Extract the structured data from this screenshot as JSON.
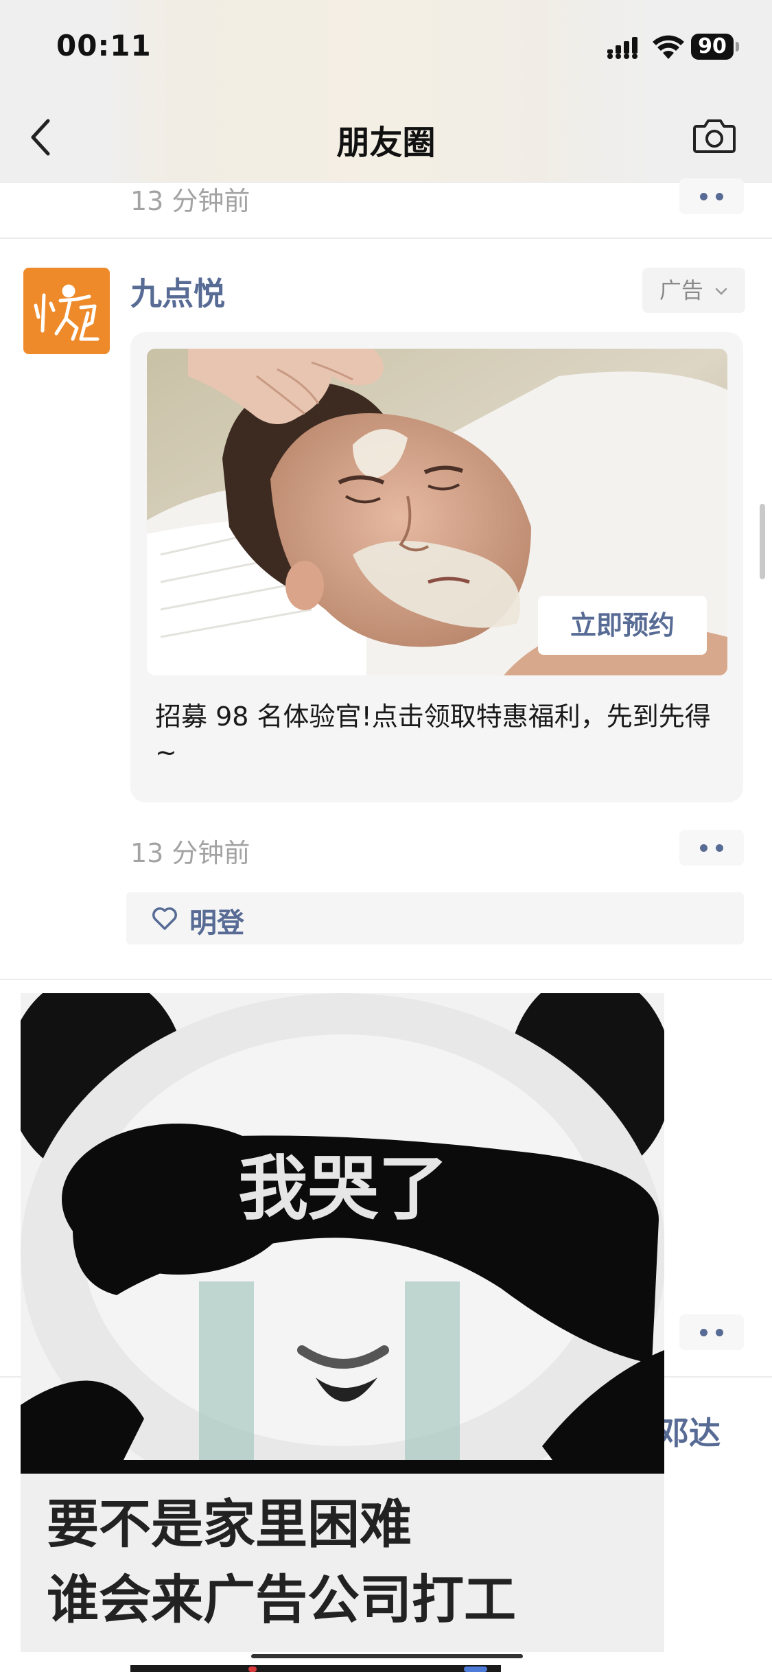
{
  "status_bar": {
    "time": "00:11",
    "battery": "90"
  },
  "nav": {
    "title": "朋友圈",
    "back_icon": "chevron-left-icon",
    "camera_icon": "camera-icon"
  },
  "prev_post": {
    "timestamp": "13 分钟前"
  },
  "ad_post": {
    "author": "九点悦",
    "ad_label": "广告",
    "cta_label": "立即预约",
    "text": "招募 98 名体验官!点击领取特惠福利，先到先得~",
    "timestamp": "13 分钟前",
    "liker": "明登"
  },
  "meme": {
    "caption_top": "我哭了",
    "caption_line1": "要不是家里困难",
    "caption_line2": "谁会来广告公司打工"
  },
  "next_post": {
    "partial_name": "邓达"
  },
  "colors": {
    "link": "#576b95",
    "timestamp": "#a3a3a3",
    "avatar_bg": "#ee8a2a"
  }
}
